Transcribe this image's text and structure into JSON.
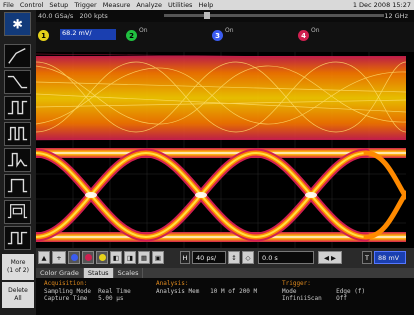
{
  "menu": {
    "items": [
      "File",
      "Control",
      "Setup",
      "Trigger",
      "Measure",
      "Analyze",
      "Utilities",
      "Help"
    ],
    "date": "1 Dec 2008 15:27"
  },
  "status": {
    "sample_rate": "40.0 GSa/s",
    "memory": "200 kpts",
    "bandwidth": "12 GHz"
  },
  "channels": [
    {
      "num": "1",
      "color": "#e6d21a",
      "value": "68.2 mV/"
    },
    {
      "num": "2",
      "color": "#20c040",
      "state": "On"
    },
    {
      "num": "3",
      "color": "#3b5cf0",
      "state": "On"
    },
    {
      "num": "4",
      "color": "#d02050",
      "state": "On"
    }
  ],
  "timebase": {
    "scale": "40 ps/",
    "position": "0.0 s",
    "trigger_level": "88 mV"
  },
  "tabs": [
    "Color Grade",
    "Status",
    "Scales"
  ],
  "active_tab": "Status",
  "sidebar": {
    "more_label": "More\n(1 of 2)",
    "delete_label": "Delete\nAll"
  },
  "info": {
    "acquisition_header": "Acquisition:",
    "acq_line1": "Sampling Mode  Real Time",
    "acq_line2": "Capture Time   5.00 µs",
    "analysis_header": "Analysis:",
    "analysis_line1": "Analysis Mem   10 M of 200 M",
    "trigger_header": "Trigger:",
    "trig_line1": "Mode           Edge (f)",
    "trig_line2": "InfiniiScan    Off"
  },
  "colors": {
    "eye_hot": "#ffffff",
    "eye_warm": "#ffd200",
    "eye_mid": "#ff7a00",
    "eye_cool": "#e0254a",
    "accent_blue": "#1a3fb0"
  }
}
